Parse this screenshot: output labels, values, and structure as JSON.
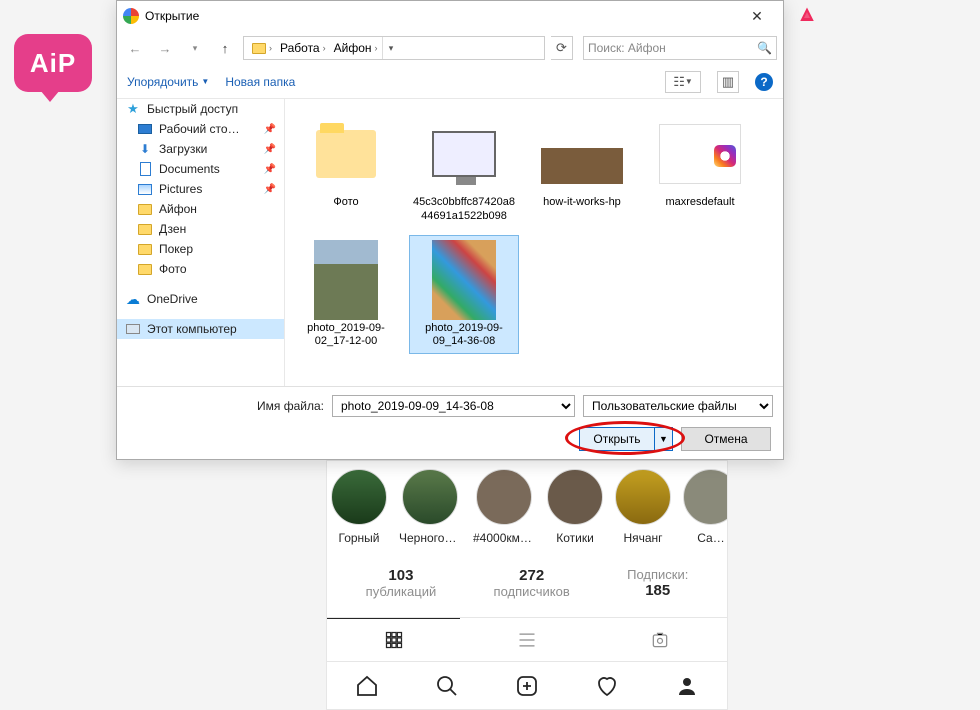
{
  "aip_logo": "AiP",
  "dialog": {
    "title": "Открытие",
    "breadcrumb": [
      "Работа",
      "Айфон"
    ],
    "search_placeholder": "Поиск: Айфон",
    "toolbar": {
      "organize": "Упорядочить",
      "new_folder": "Новая папка"
    },
    "sidebar": {
      "quick_access": "Быстрый доступ",
      "desktop": "Рабочий сто…",
      "downloads": "Загрузки",
      "documents": "Documents",
      "pictures": "Pictures",
      "iphone": "Айфон",
      "zen": "Дзен",
      "poker": "Покер",
      "photo_folder": "Фото",
      "onedrive": "OneDrive",
      "this_pc": "Этот компьютер"
    },
    "files": {
      "folder_photo": "Фото",
      "hash_img": "45c3c0bbffc87420a844691a1522b098",
      "how_it_works": "how-it-works-hp",
      "maxres": "maxresdefault",
      "photo1": "photo_2019-09-02_17-12-00",
      "photo2": "photo_2019-09-09_14-36-08"
    },
    "filename_label": "Имя файла:",
    "filename_value": "photo_2019-09-09_14-36-08",
    "filetype": "Пользовательские файлы",
    "open_btn": "Открыть",
    "cancel_btn": "Отмена"
  },
  "instagram": {
    "stories": [
      {
        "label": "Горный"
      },
      {
        "label": "Черногор…"
      },
      {
        "label": "#4000кме…"
      },
      {
        "label": "Котики"
      },
      {
        "label": "Нячанг"
      },
      {
        "label": "Са…"
      }
    ],
    "stats": {
      "posts_num": "103",
      "posts_lbl": "публикаций",
      "followers_num": "272",
      "followers_lbl": "подписчиков",
      "following_lbl": "Подписки:",
      "following_num": "185"
    }
  }
}
